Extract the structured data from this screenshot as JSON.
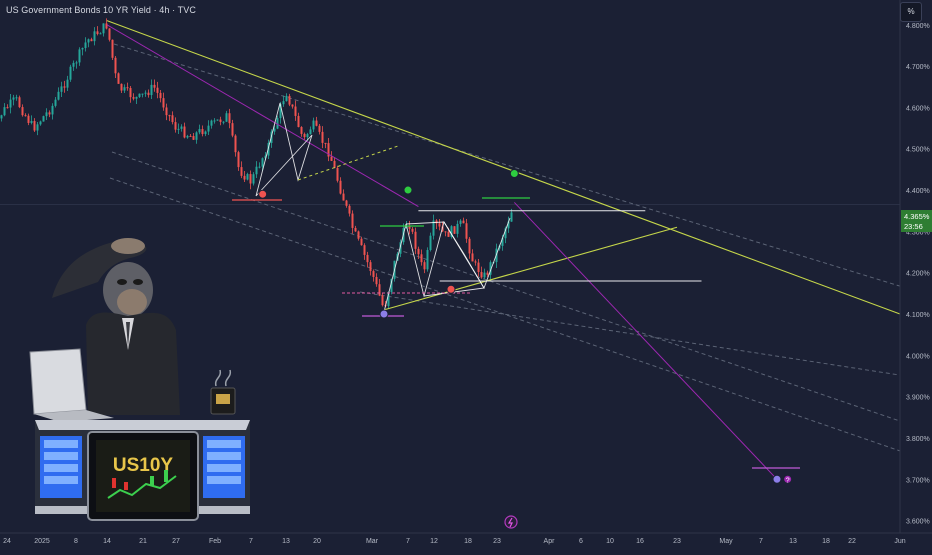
{
  "header": {
    "title": "US Government Bonds 10 YR Yield · 4h · TVC",
    "unit_button": "%"
  },
  "price_tag": {
    "value": "4.365%",
    "countdown": "23:56"
  },
  "overlay": {
    "ticker": "US10Y"
  },
  "colors": {
    "background": "#1b2034",
    "up": "#26a69a",
    "down": "#ef5350",
    "trend": "#c5d64a",
    "channel": "#5b6375",
    "pattern": "#ffffff",
    "projection": "#9c27b0",
    "price_tag": "#2e7d32"
  },
  "chart_data": {
    "type": "candlestick",
    "title": "US Government Bonds 10 YR Yield · 4h · TVC",
    "ylim": [
      3.57,
      4.86
    ],
    "y_ticks": [
      "4.800%",
      "4.700%",
      "4.600%",
      "4.500%",
      "4.400%",
      "4.300%",
      "4.200%",
      "4.100%",
      "4.000%",
      "3.900%",
      "3.800%",
      "3.700%",
      "3.600%"
    ],
    "y_tick_values": [
      4.8,
      4.7,
      4.6,
      4.5,
      4.4,
      4.3,
      4.2,
      4.1,
      4.0,
      3.9,
      3.8,
      3.7,
      3.6
    ],
    "x_ticks": [
      "24",
      "2025",
      "8",
      "14",
      "21",
      "27",
      "Feb",
      "7",
      "13",
      "20",
      "Mar",
      "7",
      "12",
      "18",
      "23",
      "Apr",
      "6",
      "10",
      "16",
      "23",
      "May",
      "7",
      "13",
      "18",
      "22",
      "Jun"
    ],
    "x_tick_dates": [
      "2024-12-24",
      "2025-01-01",
      "2025-01-08",
      "2025-01-14",
      "2025-01-21",
      "2025-01-27",
      "2025-02-01",
      "2025-02-07",
      "2025-02-13",
      "2025-02-20",
      "2025-03-01",
      "2025-03-07",
      "2025-03-12",
      "2025-03-18",
      "2025-03-23",
      "2025-04-01",
      "2025-04-06",
      "2025-04-10",
      "2025-04-16",
      "2025-04-23",
      "2025-05-01",
      "2025-05-07",
      "2025-05-13",
      "2025-05-18",
      "2025-05-22",
      "2025-06-01"
    ],
    "price_path": [
      [
        "2024-12-20",
        4.53
      ],
      [
        "2024-12-23",
        4.59
      ],
      [
        "2024-12-26",
        4.62
      ],
      [
        "2024-12-30",
        4.55
      ],
      [
        "2025-01-03",
        4.6
      ],
      [
        "2025-01-07",
        4.69
      ],
      [
        "2025-01-10",
        4.76
      ],
      [
        "2025-01-13",
        4.79
      ],
      [
        "2025-01-14",
        4.8
      ],
      [
        "2025-01-16",
        4.65
      ],
      [
        "2025-01-20",
        4.62
      ],
      [
        "2025-01-23",
        4.65
      ],
      [
        "2025-01-27",
        4.55
      ],
      [
        "2025-01-29",
        4.53
      ],
      [
        "2025-02-03",
        4.58
      ],
      [
        "2025-02-05",
        4.45
      ],
      [
        "2025-02-07",
        4.42
      ],
      [
        "2025-02-10",
        4.51
      ],
      [
        "2025-02-13",
        4.64
      ],
      [
        "2025-02-17",
        4.52
      ],
      [
        "2025-02-19",
        4.56
      ],
      [
        "2025-02-22",
        4.49
      ],
      [
        "2025-02-26",
        4.3
      ],
      [
        "2025-03-01",
        4.2
      ],
      [
        "2025-03-03",
        4.11
      ],
      [
        "2025-03-05",
        4.24
      ],
      [
        "2025-03-07",
        4.33
      ],
      [
        "2025-03-10",
        4.2
      ],
      [
        "2025-03-12",
        4.32
      ],
      [
        "2025-03-14",
        4.29
      ],
      [
        "2025-03-17",
        4.32
      ],
      [
        "2025-03-19",
        4.22
      ],
      [
        "2025-03-21",
        4.19
      ],
      [
        "2025-03-24",
        4.29
      ],
      [
        "2025-03-26",
        4.37
      ]
    ],
    "trendlines": [
      {
        "kind": "descending resistance",
        "from": [
          "2025-01-14",
          4.81
        ],
        "to": [
          "2025-06-01",
          4.1
        ]
      },
      {
        "kind": "ascending support",
        "from": [
          "2025-03-03",
          4.11
        ],
        "to": [
          "2025-04-23",
          4.31
        ]
      },
      {
        "kind": "projection",
        "from": [
          "2025-01-14",
          4.8
        ],
        "to": [
          "2025-03-09",
          4.36
        ]
      },
      {
        "kind": "projection",
        "from": [
          "2025-03-26",
          4.37
        ],
        "to": [
          "2025-05-10",
          3.7
        ]
      },
      {
        "kind": "horizontal",
        "from": [
          "2025-03-09",
          4.35
        ],
        "to": [
          "2025-04-17",
          4.35
        ]
      },
      {
        "kind": "horizontal",
        "from": [
          "2025-03-13",
          4.18
        ],
        "to": [
          "2025-04-27",
          4.18
        ]
      }
    ],
    "markers": [
      {
        "date": "2025-02-09",
        "value": 4.39,
        "color": "#ef5350"
      },
      {
        "date": "2025-03-03",
        "value": 4.1,
        "color": "#8c7ee8"
      },
      {
        "date": "2025-03-07",
        "value": 4.4,
        "color": "#2ecc40"
      },
      {
        "date": "2025-03-15",
        "value": 4.16,
        "color": "#ef5350"
      },
      {
        "date": "2025-03-26",
        "value": 4.44,
        "color": "#2ecc40"
      },
      {
        "date": "2025-05-10",
        "value": 3.7,
        "color": "#8c7ee8"
      },
      {
        "date": "2025-05-12",
        "value": 3.7,
        "color": "#9c27b0",
        "label": "?"
      }
    ]
  }
}
